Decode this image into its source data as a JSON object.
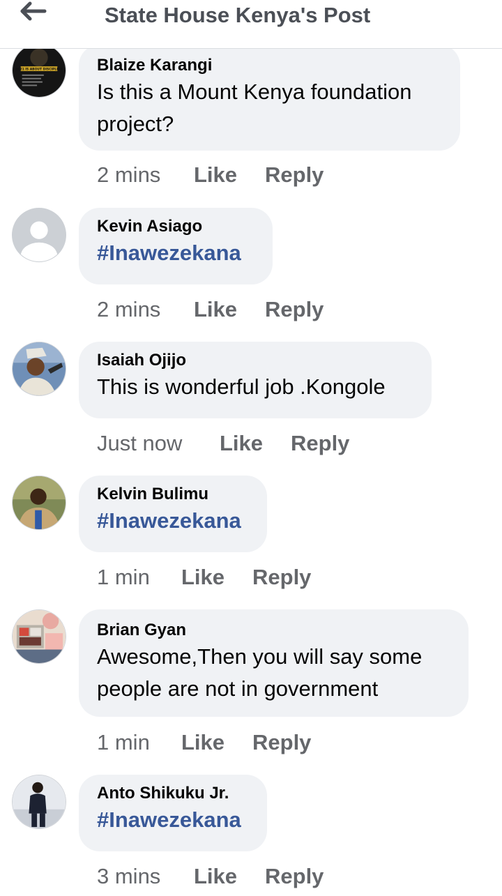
{
  "header": {
    "title": "State House Kenya's Post",
    "back_icon": "arrow-left-icon"
  },
  "actions": {
    "like": "Like",
    "reply": "Reply"
  },
  "comments": [
    {
      "author": "Blaize Karangi",
      "text": "Is this a Mount Kenya foundation project?",
      "time": "2 mins",
      "avatar_icon": "poster-avatar",
      "avatar_text": "2021 IS ABOUT DISCIPLINE"
    },
    {
      "author": "Kevin Asiago",
      "text": "#Inawezekana",
      "time": "2 mins",
      "avatar_icon": "default-user-icon"
    },
    {
      "author": "Isaiah Ojijo",
      "text": "This is wonderful job .Kongole",
      "time": "Just now",
      "avatar_icon": "person-photo"
    },
    {
      "author": "Kelvin Bulimu",
      "text": "#Inawezekana",
      "time": "1 min",
      "avatar_icon": "person-photo"
    },
    {
      "author": "Brian Gyan",
      "text": "Awesome,Then you will say some people are not in government",
      "time": "1 min",
      "avatar_icon": "collage-photo"
    },
    {
      "author": "Anto Shikuku Jr.",
      "text": "#Inawezekana",
      "time": "3 mins",
      "avatar_icon": "person-photo"
    }
  ],
  "colors": {
    "bubble": "#f0f2f5",
    "hashtag": "#385898",
    "meta": "#65676b",
    "header_title": "#4b4f56"
  }
}
